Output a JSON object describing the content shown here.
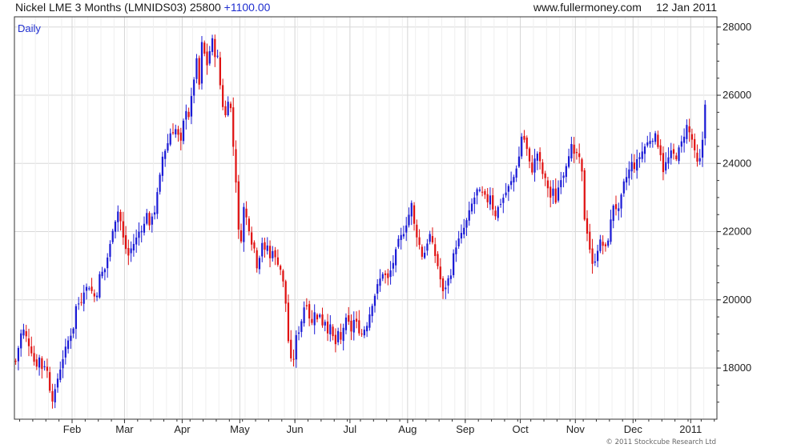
{
  "header": {
    "instrument": "Nickel LME 3 Months (LMNIDS03)",
    "last": "25800",
    "change": "+1100.00",
    "site": "www.fullermoney.com",
    "date": "12 Jan 2011"
  },
  "credit": "© 2011 Stockcube Research Ltd",
  "chart_data": {
    "type": "candlestick",
    "period_label": "Daily",
    "up_color": "#1a1ad6",
    "down_color": "#e01010",
    "ylim": [
      16500,
      28300
    ],
    "y_ticks": [
      "18000",
      "20000",
      "22000",
      "24000",
      "26000",
      "28000"
    ],
    "x_ticks": [
      "Feb",
      "Mar",
      "Apr",
      "May",
      "Jun",
      "Jul",
      "Aug",
      "Sep",
      "Oct",
      "Nov",
      "Dec",
      "2011"
    ],
    "x_tick_days": [
      22,
      42,
      64,
      86,
      107,
      128,
      150,
      172,
      193,
      214,
      236,
      258
    ],
    "days": [
      0,
      268
    ],
    "close_path": [
      [
        0,
        18200
      ],
      [
        1,
        18600
      ],
      [
        2,
        19000
      ],
      [
        3,
        19100
      ],
      [
        4,
        18900
      ],
      [
        6,
        18500
      ],
      [
        7,
        18200
      ],
      [
        8,
        18100
      ],
      [
        9,
        18300
      ],
      [
        10,
        18000
      ],
      [
        11,
        18100
      ],
      [
        12,
        17900
      ],
      [
        13,
        17400
      ],
      [
        14,
        17100
      ],
      [
        15,
        17300
      ],
      [
        16,
        17700
      ],
      [
        18,
        18300
      ],
      [
        20,
        18800
      ],
      [
        22,
        19200
      ],
      [
        23,
        19800
      ],
      [
        25,
        20000
      ],
      [
        26,
        20300
      ],
      [
        28,
        20400
      ],
      [
        30,
        20100
      ],
      [
        31,
        20200
      ],
      [
        32,
        20700
      ],
      [
        34,
        20900
      ],
      [
        36,
        21600
      ],
      [
        37,
        22100
      ],
      [
        39,
        22600
      ],
      [
        40,
        22300
      ],
      [
        41,
        21800
      ],
      [
        42,
        21500
      ],
      [
        43,
        21300
      ],
      [
        44,
        21500
      ],
      [
        46,
        21800
      ],
      [
        47,
        22000
      ],
      [
        49,
        22200
      ],
      [
        50,
        22600
      ],
      [
        51,
        22100
      ],
      [
        52,
        22500
      ],
      [
        53,
        22600
      ],
      [
        55,
        23600
      ],
      [
        56,
        24200
      ],
      [
        58,
        24600
      ],
      [
        59,
        24900
      ],
      [
        61,
        25000
      ],
      [
        62,
        24800
      ],
      [
        63,
        24600
      ],
      [
        64,
        25200
      ],
      [
        65,
        25600
      ],
      [
        66,
        25400
      ],
      [
        67,
        25900
      ],
      [
        68,
        26500
      ],
      [
        69,
        27000
      ],
      [
        70,
        26300
      ],
      [
        71,
        27500
      ],
      [
        72,
        27200
      ],
      [
        73,
        26900
      ],
      [
        74,
        27300
      ],
      [
        75,
        27600
      ],
      [
        76,
        27200
      ],
      [
        77,
        27100
      ],
      [
        78,
        26300
      ],
      [
        79,
        25700
      ],
      [
        80,
        25400
      ],
      [
        81,
        25900
      ],
      [
        82,
        25600
      ],
      [
        83,
        24500
      ],
      [
        84,
        23500
      ],
      [
        85,
        22000
      ],
      [
        86,
        21800
      ],
      [
        87,
        22700
      ],
      [
        88,
        22400
      ],
      [
        89,
        22100
      ],
      [
        90,
        21700
      ],
      [
        91,
        21500
      ],
      [
        92,
        21000
      ],
      [
        93,
        21300
      ],
      [
        94,
        21700
      ],
      [
        95,
        21400
      ],
      [
        96,
        21600
      ],
      [
        97,
        21200
      ],
      [
        98,
        21500
      ],
      [
        99,
        21200
      ],
      [
        100,
        21100
      ],
      [
        101,
        20900
      ],
      [
        102,
        20500
      ],
      [
        103,
        19900
      ],
      [
        104,
        18800
      ],
      [
        105,
        18200
      ],
      [
        106,
        18300
      ],
      [
        107,
        18900
      ],
      [
        108,
        19100
      ],
      [
        109,
        19400
      ],
      [
        110,
        19800
      ],
      [
        111,
        19900
      ],
      [
        112,
        19500
      ],
      [
        113,
        19300
      ],
      [
        114,
        19700
      ],
      [
        115,
        19400
      ],
      [
        116,
        19600
      ],
      [
        117,
        19300
      ],
      [
        118,
        19400
      ],
      [
        119,
        19100
      ],
      [
        120,
        19200
      ],
      [
        121,
        18900
      ],
      [
        122,
        18700
      ],
      [
        123,
        19000
      ],
      [
        124,
        18800
      ],
      [
        125,
        19200
      ],
      [
        126,
        19400
      ],
      [
        127,
        19300
      ],
      [
        128,
        19100
      ],
      [
        129,
        19400
      ],
      [
        130,
        19300
      ],
      [
        131,
        19100
      ],
      [
        132,
        19000
      ],
      [
        134,
        19300
      ],
      [
        136,
        19900
      ],
      [
        138,
        20400
      ],
      [
        140,
        20800
      ],
      [
        142,
        20600
      ],
      [
        144,
        21100
      ],
      [
        146,
        21700
      ],
      [
        148,
        22000
      ],
      [
        150,
        22500
      ],
      [
        151,
        22800
      ],
      [
        152,
        22200
      ],
      [
        153,
        21900
      ],
      [
        154,
        21600
      ],
      [
        155,
        21300
      ],
      [
        156,
        21400
      ],
      [
        157,
        21700
      ],
      [
        158,
        21900
      ],
      [
        159,
        21600
      ],
      [
        160,
        21300
      ],
      [
        161,
        21000
      ],
      [
        162,
        20600
      ],
      [
        163,
        20200
      ],
      [
        164,
        20400
      ],
      [
        165,
        20600
      ],
      [
        166,
        20800
      ],
      [
        167,
        21300
      ],
      [
        168,
        21600
      ],
      [
        170,
        21900
      ],
      [
        172,
        22300
      ],
      [
        174,
        22800
      ],
      [
        176,
        23200
      ],
      [
        178,
        23100
      ],
      [
        180,
        22900
      ],
      [
        181,
        23100
      ],
      [
        182,
        22700
      ],
      [
        183,
        22500
      ],
      [
        184,
        22700
      ],
      [
        186,
        23000
      ],
      [
        188,
        23300
      ],
      [
        190,
        23600
      ],
      [
        192,
        24200
      ],
      [
        193,
        24800
      ],
      [
        194,
        24700
      ],
      [
        195,
        24400
      ],
      [
        196,
        24000
      ],
      [
        197,
        23800
      ],
      [
        198,
        24100
      ],
      [
        199,
        24300
      ],
      [
        200,
        24000
      ],
      [
        201,
        23700
      ],
      [
        202,
        23500
      ],
      [
        203,
        23300
      ],
      [
        204,
        23000
      ],
      [
        205,
        23200
      ],
      [
        206,
        22900
      ],
      [
        207,
        23300
      ],
      [
        208,
        23600
      ],
      [
        209,
        23700
      ],
      [
        210,
        24000
      ],
      [
        211,
        24300
      ],
      [
        212,
        24500
      ],
      [
        213,
        24200
      ],
      [
        214,
        24300
      ],
      [
        215,
        24100
      ],
      [
        216,
        23700
      ],
      [
        217,
        22400
      ],
      [
        218,
        22000
      ],
      [
        219,
        21500
      ],
      [
        220,
        21000
      ],
      [
        221,
        21200
      ],
      [
        222,
        21500
      ],
      [
        223,
        21700
      ],
      [
        224,
        21600
      ],
      [
        225,
        21500
      ],
      [
        226,
        21800
      ],
      [
        227,
        22300
      ],
      [
        228,
        22800
      ],
      [
        229,
        22700
      ],
      [
        230,
        22600
      ],
      [
        231,
        23000
      ],
      [
        232,
        23400
      ],
      [
        233,
        23600
      ],
      [
        234,
        23800
      ],
      [
        235,
        24000
      ],
      [
        236,
        23900
      ],
      [
        238,
        24200
      ],
      [
        240,
        24500
      ],
      [
        242,
        24700
      ],
      [
        244,
        24800
      ],
      [
        246,
        24300
      ],
      [
        247,
        23800
      ],
      [
        248,
        24000
      ],
      [
        250,
        24300
      ],
      [
        252,
        24200
      ],
      [
        254,
        24600
      ],
      [
        256,
        25100
      ],
      [
        257,
        24900
      ],
      [
        258,
        24700
      ],
      [
        259,
        24300
      ],
      [
        260,
        24000
      ],
      [
        261,
        24100
      ],
      [
        262,
        24700
      ],
      [
        263,
        25800
      ]
    ]
  }
}
